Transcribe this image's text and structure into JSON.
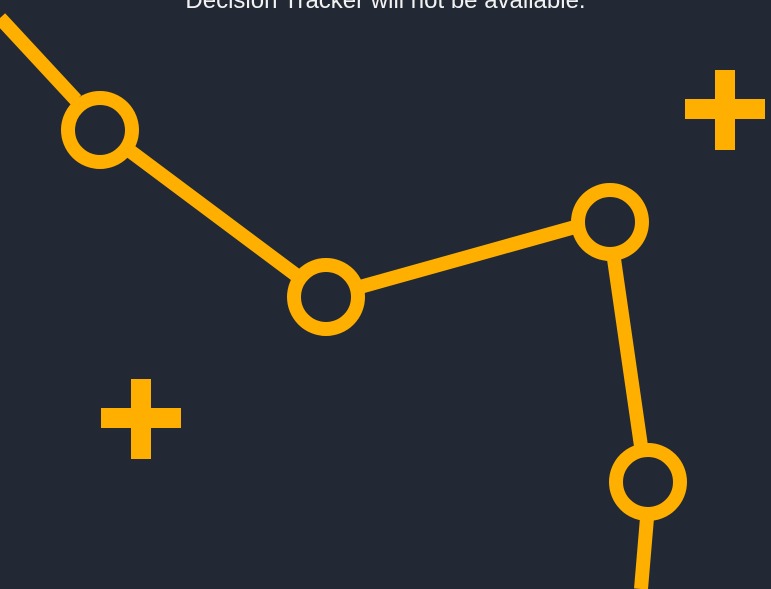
{
  "message": {
    "text": "Decision Tracker will not be available."
  },
  "illustration": {
    "accent_color": "#FFAF00",
    "background_color": "#222834",
    "icons": [
      "timeline-path-icon",
      "plus-icon",
      "plus-icon"
    ]
  }
}
